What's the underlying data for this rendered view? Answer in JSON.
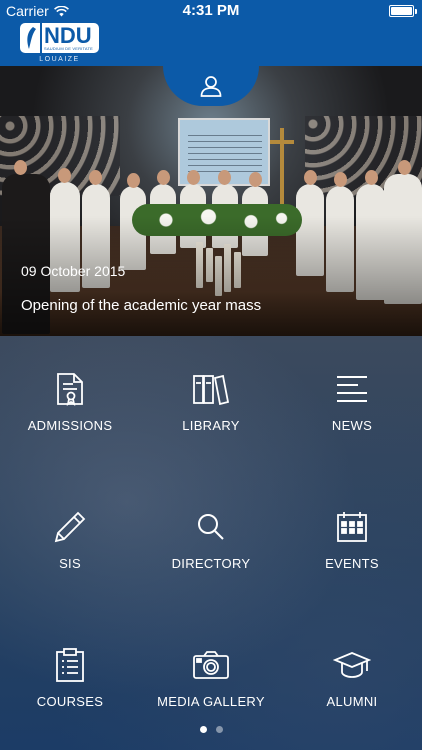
{
  "status_bar": {
    "carrier": "Carrier",
    "time": "4:31 PM"
  },
  "header": {
    "logo_text": "NDU",
    "logo_subtitle": "SAUDIUM DE VERITATE",
    "logo_city": "LOUAIZE",
    "color": "#0c5aa8"
  },
  "hero": {
    "date": "09 October 2015",
    "title": "Opening of the academic year mass"
  },
  "profile_button": {
    "icon": "user-icon"
  },
  "menu": [
    {
      "label": "ADMISSIONS",
      "icon": "certificate-document-icon"
    },
    {
      "label": "LIBRARY",
      "icon": "books-icon"
    },
    {
      "label": "NEWS",
      "icon": "menu-lines-icon"
    },
    {
      "label": "SIS",
      "icon": "pencil-icon"
    },
    {
      "label": "DIRECTORY",
      "icon": "search-icon"
    },
    {
      "label": "EVENTS",
      "icon": "calendar-icon"
    },
    {
      "label": "COURSES",
      "icon": "clipboard-list-icon"
    },
    {
      "label": "MEDIA GALLERY",
      "icon": "camera-icon"
    },
    {
      "label": "ALUMNI",
      "icon": "graduation-cap-icon"
    }
  ],
  "pagination": {
    "pages": 2,
    "current": 1
  }
}
